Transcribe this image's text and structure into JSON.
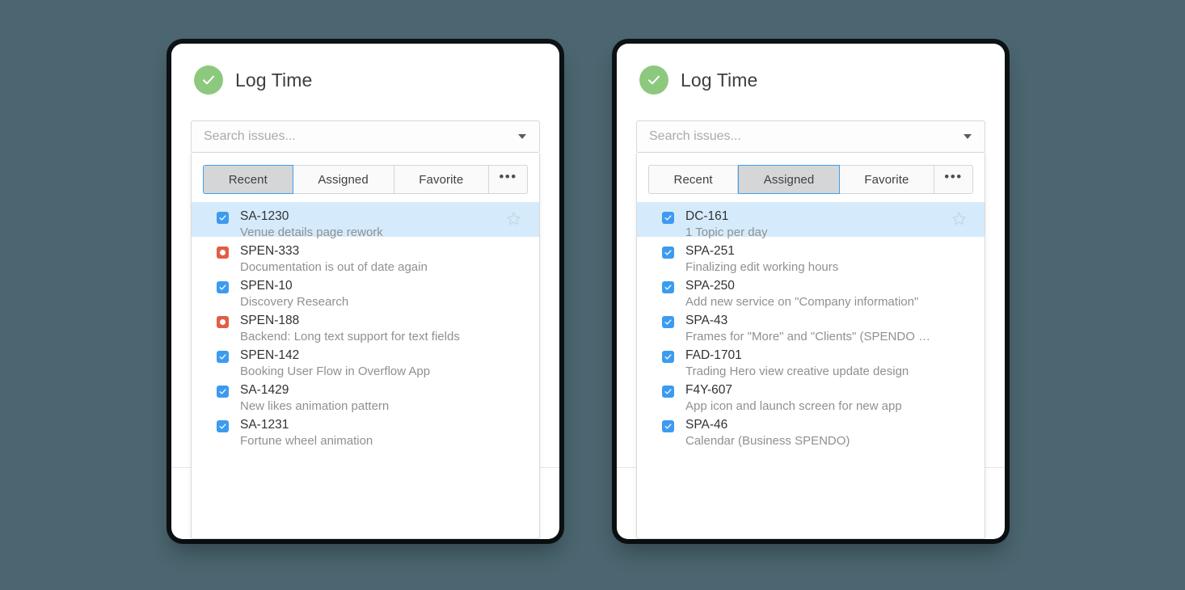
{
  "background_color": "#4b6670",
  "accent_colors": {
    "status_green": "#8cc97e",
    "checkbox_blue": "#3c9bf0",
    "bug_red": "#e35d43",
    "selected_row_blue": "#d5ebfb",
    "active_tab_border": "#3ea0f0",
    "active_tab_fill": "#d5d6d7"
  },
  "panels": [
    {
      "id": "left-panel",
      "header": {
        "status_icon": "check-circle-icon",
        "title": "Log Time"
      },
      "search": {
        "placeholder": "Search issues...",
        "value": "",
        "dropdown_icon": "chevron-down-icon"
      },
      "tabs": [
        {
          "label": "Recent",
          "active": true
        },
        {
          "label": "Assigned",
          "active": false
        },
        {
          "label": "Favorite",
          "active": false
        },
        {
          "label": "•••",
          "active": false,
          "name": "more-options"
        }
      ],
      "issues": [
        {
          "icon": "checkbox-icon",
          "key": "SA-1230",
          "summary": "Venue details page rework",
          "selected": true,
          "star": true
        },
        {
          "icon": "bug-icon",
          "key": "SPEN-333",
          "summary": "Documentation is out of date again",
          "selected": false,
          "star": false
        },
        {
          "icon": "checkbox-icon",
          "key": "SPEN-10",
          "summary": "Discovery Research",
          "selected": false,
          "star": false
        },
        {
          "icon": "bug-icon",
          "key": "SPEN-188",
          "summary": "Backend: Long text support for text fields",
          "selected": false,
          "star": false
        },
        {
          "icon": "checkbox-icon",
          "key": "SPEN-142",
          "summary": "Booking User Flow in Overflow App",
          "selected": false,
          "star": false
        },
        {
          "icon": "checkbox-icon",
          "key": "SA-1429",
          "summary": "New likes animation pattern",
          "selected": false,
          "star": false
        },
        {
          "icon": "checkbox-icon",
          "key": "SA-1231",
          "summary": "Fortune wheel animation",
          "selected": false,
          "star": false
        }
      ]
    },
    {
      "id": "right-panel",
      "header": {
        "status_icon": "check-circle-icon",
        "title": "Log Time"
      },
      "search": {
        "placeholder": "Search issues...",
        "value": "",
        "dropdown_icon": "chevron-down-icon"
      },
      "tabs": [
        {
          "label": "Recent",
          "active": false
        },
        {
          "label": "Assigned",
          "active": true
        },
        {
          "label": "Favorite",
          "active": false
        },
        {
          "label": "•••",
          "active": false,
          "name": "more-options"
        }
      ],
      "issues": [
        {
          "icon": "checkbox-icon",
          "key": "DC-161",
          "summary": "1 Topic per day",
          "selected": true,
          "star": true
        },
        {
          "icon": "checkbox-icon",
          "key": "SPA-251",
          "summary": "Finalizing edit working hours",
          "selected": false,
          "star": false
        },
        {
          "icon": "checkbox-icon",
          "key": "SPA-250",
          "summary": "Add new service on \"Company information\"",
          "selected": false,
          "star": false
        },
        {
          "icon": "checkbox-icon",
          "key": "SPA-43",
          "summary": "Frames for \"More\" and \"Clients\" (SPENDO …",
          "selected": false,
          "star": false
        },
        {
          "icon": "checkbox-icon",
          "key": "FAD-1701",
          "summary": "Trading Hero view creative update design",
          "selected": false,
          "star": false
        },
        {
          "icon": "checkbox-icon",
          "key": "F4Y-607",
          "summary": "App icon and launch screen for new app",
          "selected": false,
          "star": false
        },
        {
          "icon": "checkbox-icon",
          "key": "SPA-46",
          "summary": "Calendar (Business SPENDO)",
          "selected": false,
          "star": false
        }
      ]
    }
  ]
}
